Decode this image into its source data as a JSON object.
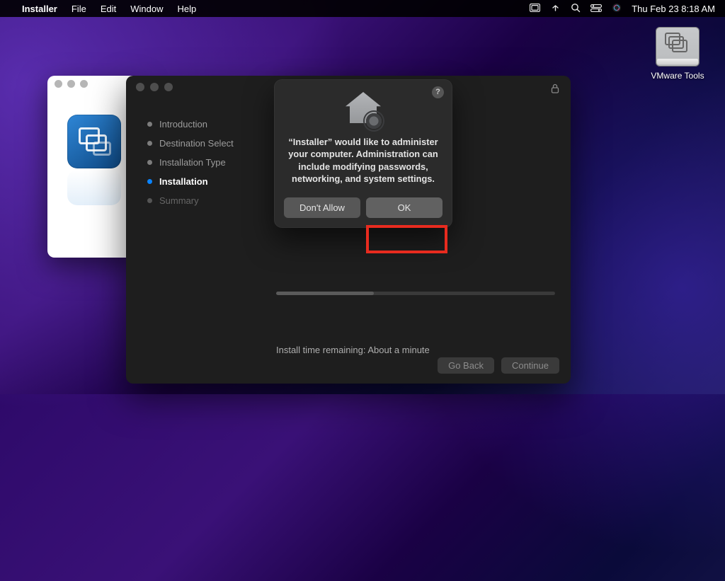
{
  "menubar": {
    "app": "Installer",
    "items": [
      "File",
      "Edit",
      "Window",
      "Help"
    ],
    "clock": "Thu Feb 23  8:18 AM"
  },
  "desktop": {
    "vmware_tools_label": "VMware Tools"
  },
  "installer": {
    "steps": [
      {
        "label": "Introduction",
        "state": "done"
      },
      {
        "label": "Destination Select",
        "state": "done"
      },
      {
        "label": "Installation Type",
        "state": "done"
      },
      {
        "label": "Installation",
        "state": "active"
      },
      {
        "label": "Summary",
        "state": ""
      }
    ],
    "status_text": "Install time remaining: About a minute",
    "go_back": "Go Back",
    "continue": "Continue"
  },
  "dialog": {
    "message": "“Installer” would like to administer your computer. Administration can include modifying passwords, networking, and system settings.",
    "dont_allow": "Don't Allow",
    "ok": "OK",
    "help": "?"
  }
}
